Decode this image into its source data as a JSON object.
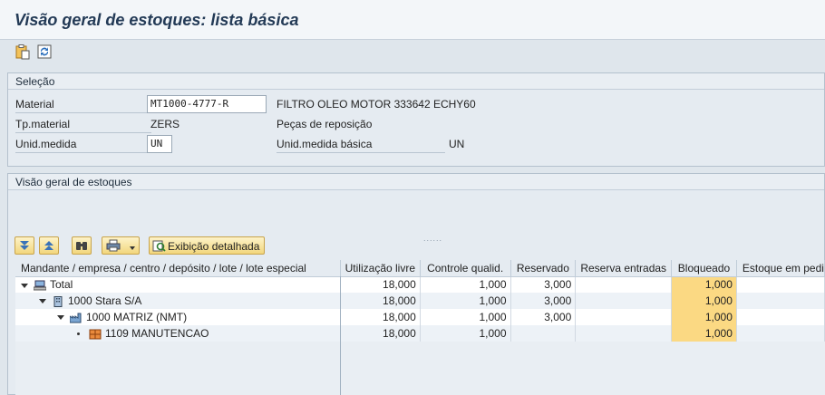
{
  "window": {
    "title": "Visão geral de estoques: lista básica"
  },
  "toolbar": {
    "icons": [
      "clipboard-icon",
      "refresh-icon"
    ]
  },
  "selection": {
    "title": "Seleção",
    "material": {
      "label": "Material",
      "value": "MT1000-4777-R",
      "description": "FILTRO OLEO MOTOR 333642 ECHY60"
    },
    "material_type": {
      "label": "Tp.material",
      "value": "ZERS",
      "description": "Peças de reposição"
    },
    "unit": {
      "label": "Unid.medida",
      "value": "UN",
      "base_label": "Unid.medida básica",
      "base_value": "UN"
    }
  },
  "overview": {
    "title": "Visão geral de estoques",
    "splitter": "......",
    "toolbar": {
      "detail_button": "Exibição detalhada"
    },
    "columns": [
      "Mandante / empresa / centro / depósito / lote / lote especial",
      "Utilização livre",
      "Controle qualid.",
      "Reservado",
      "Reserva entradas",
      "Bloqueado",
      "Estoque em pedi"
    ],
    "rows": [
      {
        "name": "Total",
        "free": "18,000",
        "qc": "1,000",
        "reserved": "3,000",
        "res_in": "",
        "blocked": "1,000",
        "ordered": ""
      },
      {
        "name": "1000 Stara S/A",
        "free": "18,000",
        "qc": "1,000",
        "reserved": "3,000",
        "res_in": "",
        "blocked": "1,000",
        "ordered": ""
      },
      {
        "name": "1000 MATRIZ (NMT)",
        "free": "18,000",
        "qc": "1,000",
        "reserved": "3,000",
        "res_in": "",
        "blocked": "1,000",
        "ordered": ""
      },
      {
        "name": "1109 MANUTENCAO",
        "free": "18,000",
        "qc": "1,000",
        "reserved": "",
        "res_in": "",
        "blocked": "1,000",
        "ordered": ""
      }
    ]
  },
  "colors": {
    "highlight": "#fbd983",
    "title": "#233a56"
  }
}
